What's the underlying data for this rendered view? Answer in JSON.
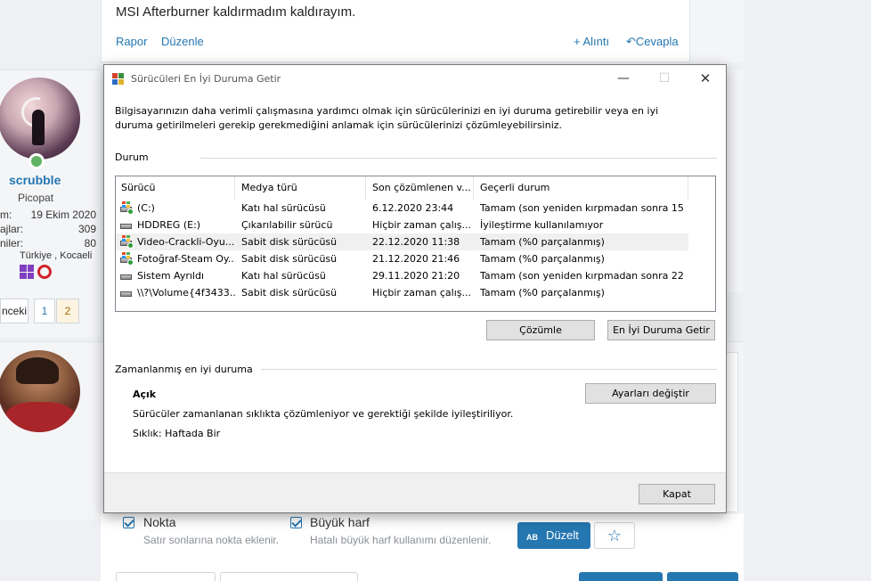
{
  "forum": {
    "top_post": {
      "message": "MSI Afterburner kaldırmadım kaldırayım.",
      "report_label": "Rapor",
      "edit_label": "Düzenle",
      "quote_label": "+ Alıntı",
      "reply_label": "Cevapla"
    },
    "user": {
      "name": "scrubble",
      "title": "Picopat",
      "stats": [
        {
          "key": "m:",
          "value": "19 Ekim 2020"
        },
        {
          "key": "ajlar:",
          "value": "309"
        },
        {
          "key": "niler:",
          "value": "80"
        }
      ],
      "location": "Türkiye , Kocaeli"
    },
    "pager": {
      "prev_label": "nceki",
      "page1": "1",
      "page2": "2"
    },
    "editor": {
      "option1_label": "Nokta",
      "option1_desc": "Satır sonlarına nokta eklenir.",
      "option2_label": "Büyük harf",
      "option2_desc": "Hatalı büyük harf kullanımı düzenlenir.",
      "fix_icon_text": "AB",
      "fix_label": "Düzelt",
      "star_icon": "☆"
    }
  },
  "dialog": {
    "title": "Sürücüleri En İyi Duruma Getir",
    "minimize_glyph": "—",
    "maximize_glyph": "☐",
    "close_glyph": "✕",
    "intro": "Bilgisayarınızın daha verimli çalışmasına yardımcı olmak için sürücülerinizi en iyi duruma getirebilir veya en iyi duruma getirilmeleri gerekip gerekmediğini anlamak için sürücülerinizi çözümleyebilirsiniz.",
    "status_section": "Durum",
    "columns": [
      "Sürücü",
      "Medya türü",
      "Son çözümlenen v...",
      "Geçerli durum"
    ],
    "drives": [
      {
        "name": "(C:)",
        "media": "Katı hal sürücüsü",
        "last": "6.12.2020 23:44",
        "status": "Tamam (son yeniden kırpmadan sonra 15 ...",
        "icon": "windows-drive-icon",
        "selected": false
      },
      {
        "name": "HDDREG (E:)",
        "media": "Çıkarılabilir sürücü",
        "last": "Hiçbir zaman çalış...",
        "status": "İyileştirme kullanılamıyor",
        "icon": "drive-icon",
        "selected": false
      },
      {
        "name": "Video-Crackli-Oyu...",
        "media": "Sabit disk sürücüsü",
        "last": "22.12.2020 11:38",
        "status": "Tamam (%0 parçalanmış)",
        "icon": "windows-drive-icon",
        "selected": true
      },
      {
        "name": "Fotoğraf-Steam Oy...",
        "media": "Sabit disk sürücüsü",
        "last": "21.12.2020 21:46",
        "status": "Tamam (%0 parçalanmış)",
        "icon": "windows-drive-icon",
        "selected": false
      },
      {
        "name": "Sistem Ayrıldı",
        "media": "Katı hal sürücüsü",
        "last": "29.11.2020 21:20",
        "status": "Tamam (son yeniden kırpmadan sonra 22 ...",
        "icon": "drive-icon",
        "selected": false
      },
      {
        "name": "\\\\?\\Volume{4f3433...",
        "media": "Sabit disk sürücüsü",
        "last": "Hiçbir zaman çalış...",
        "status": "Tamam (%0 parçalanmış)",
        "icon": "drive-icon",
        "selected": false
      }
    ],
    "analyze_label": "Çözümle",
    "optimize_label": "En İyi Duruma Getir",
    "scheduled_section": "Zamanlanmış en iyi duruma",
    "scheduled_status": "Açık",
    "change_settings_label": "Ayarları değiştir",
    "scheduled_desc": "Sürücüler zamanlanan sıklıkta çözümleniyor ve gerektiği şekilde iyileştiriliyor.",
    "frequency": "Sıklık: Haftada Bir",
    "close_label": "Kapat"
  }
}
